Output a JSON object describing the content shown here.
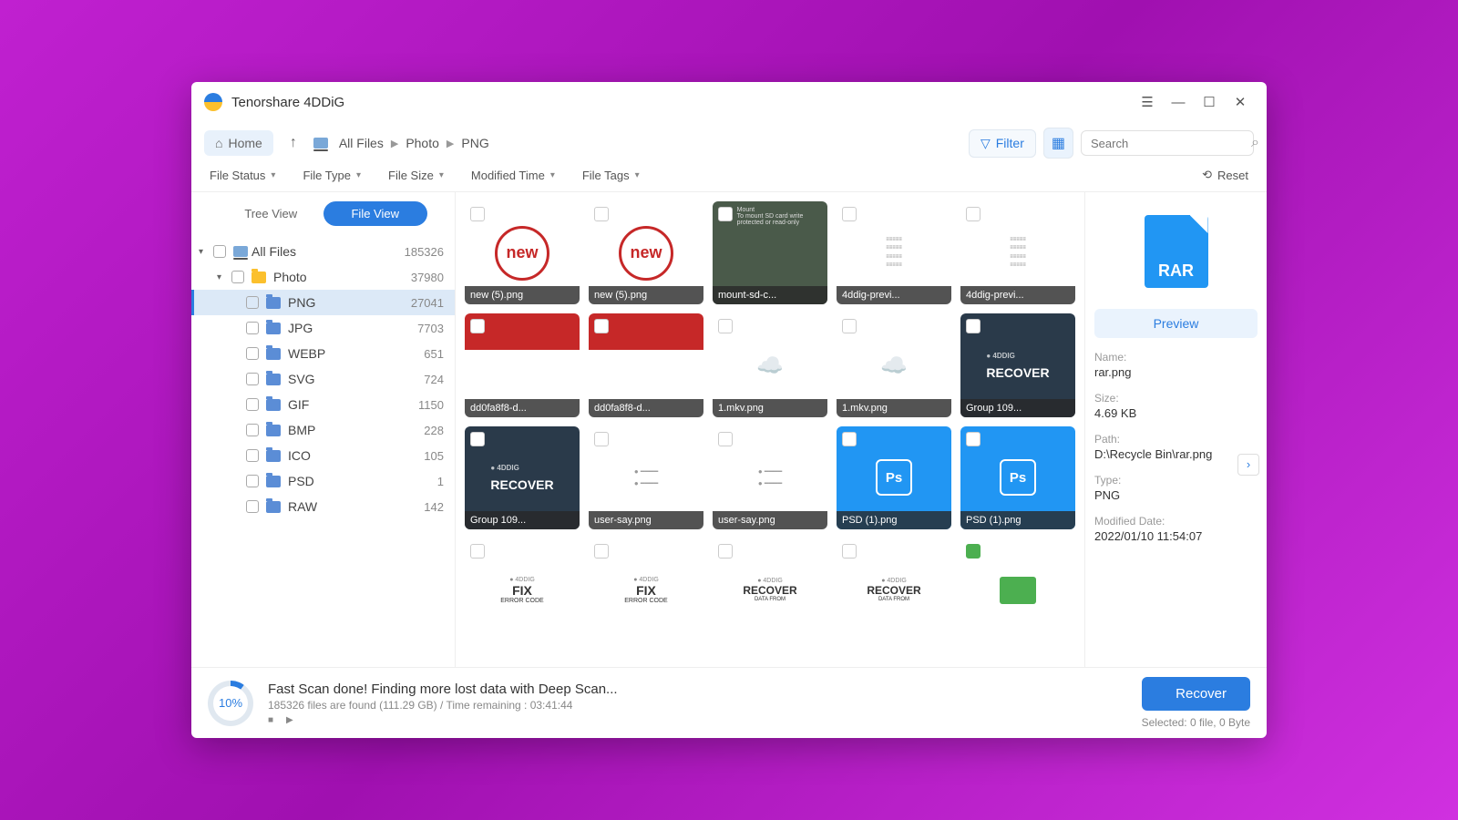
{
  "app": {
    "title": "Tenorshare 4DDiG"
  },
  "toolbar": {
    "home": "Home",
    "breadcrumb": [
      "All Files",
      "Photo",
      "PNG"
    ],
    "filter": "Filter",
    "search_placeholder": "Search"
  },
  "filters": {
    "status": "File Status",
    "type": "File Type",
    "size": "File Size",
    "modified": "Modified Time",
    "tags": "File Tags",
    "reset": "Reset"
  },
  "view": {
    "tree": "Tree View",
    "file": "File View"
  },
  "tree": {
    "root": {
      "label": "All Files",
      "count": "185326"
    },
    "photo": {
      "label": "Photo",
      "count": "37980"
    },
    "items": [
      {
        "label": "PNG",
        "count": "27041",
        "active": true
      },
      {
        "label": "JPG",
        "count": "7703"
      },
      {
        "label": "WEBP",
        "count": "651"
      },
      {
        "label": "SVG",
        "count": "724"
      },
      {
        "label": "GIF",
        "count": "1150"
      },
      {
        "label": "BMP",
        "count": "228"
      },
      {
        "label": "ICO",
        "count": "105"
      },
      {
        "label": "PSD",
        "count": "1"
      },
      {
        "label": "RAW",
        "count": "142"
      }
    ]
  },
  "files": [
    {
      "name": "new (5).png",
      "kind": "new"
    },
    {
      "name": "new (5).png",
      "kind": "new"
    },
    {
      "name": "mount-sd-c...",
      "kind": "dark-text"
    },
    {
      "name": "4ddig-previ...",
      "kind": "list"
    },
    {
      "name": "4ddig-previ...",
      "kind": "list"
    },
    {
      "name": "dd0fa8f8-d...",
      "kind": "red"
    },
    {
      "name": "dd0fa8f8-d...",
      "kind": "red"
    },
    {
      "name": "1.mkv.png",
      "kind": "cloud"
    },
    {
      "name": "1.mkv.png",
      "kind": "cloud"
    },
    {
      "name": "Group 109...",
      "kind": "recover"
    },
    {
      "name": "Group 109...",
      "kind": "recover"
    },
    {
      "name": "user-say.png",
      "kind": "chat"
    },
    {
      "name": "user-say.png",
      "kind": "chat"
    },
    {
      "name": "PSD (1).png",
      "kind": "ps"
    },
    {
      "name": "PSD (1).png",
      "kind": "ps"
    },
    {
      "name": "",
      "kind": "fix"
    },
    {
      "name": "",
      "kind": "fix"
    },
    {
      "name": "",
      "kind": "recover2"
    },
    {
      "name": "",
      "kind": "recover2"
    },
    {
      "name": "",
      "kind": "green",
      "checked": true
    }
  ],
  "preview": {
    "button": "Preview",
    "name_label": "Name:",
    "name": "rar.png",
    "size_label": "Size:",
    "size": "4.69 KB",
    "path_label": "Path:",
    "path": "D:\\Recycle Bin\\rar.png",
    "type_label": "Type:",
    "type": "PNG",
    "modified_label": "Modified Date:",
    "modified": "2022/01/10 11:54:07",
    "rar_text": "RAR"
  },
  "footer": {
    "percent": "10%",
    "title": "Fast Scan done! Finding more lost data with Deep Scan...",
    "sub": "185326 files are found (111.29 GB) /  Time remaining : 03:41:44",
    "recover": "Recover",
    "selected": "Selected: 0 file, 0 Byte"
  }
}
